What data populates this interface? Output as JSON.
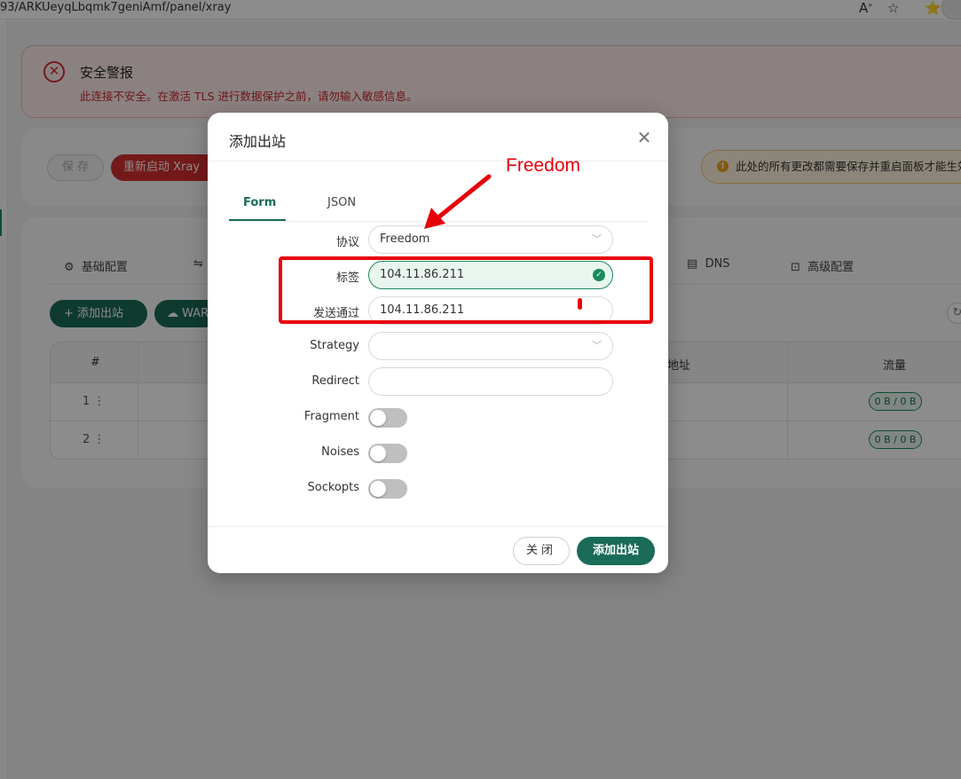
{
  "browser": {
    "url": "93/ARKUeyqLbqmk7geniAmf/panel/xray",
    "icons": [
      "read-aloud-icon",
      "favorite-star-icon",
      "reading-list-icon"
    ]
  },
  "alert": {
    "title": "安全警报",
    "description": "此连接不安全。在激活 TLS 进行数据保护之前，请勿输入敏感信息。"
  },
  "toolbar": {
    "save_label": "保 存",
    "restart_label": "重新启动 Xray",
    "notice": "此处的所有更改都需要保存并重启面板才能生效"
  },
  "page_tabs": [
    {
      "icon": "gear-icon",
      "label": "基础配置"
    },
    {
      "icon": "swap-icon",
      "label": ""
    },
    {
      "icon": "list-icon",
      "label": "DNS"
    },
    {
      "icon": "terminal-icon",
      "label": "高级配置"
    }
  ],
  "actions": {
    "add_outbound": "+ 添加出站",
    "warp": "WARP"
  },
  "table": {
    "headers": {
      "num": "#",
      "address": "地址",
      "traffic": "流量"
    },
    "rows": [
      {
        "num": "1",
        "traffic": "0 B / 0 B"
      },
      {
        "num": "2",
        "traffic": "0 B / 0 B"
      }
    ]
  },
  "modal": {
    "title": "添加出站",
    "tabs": {
      "form": "Form",
      "json": "JSON"
    },
    "fields": {
      "protocol": {
        "label": "协议",
        "value": "Freedom"
      },
      "tag": {
        "label": "标签",
        "value": "104.11.86.211"
      },
      "send_through": {
        "label": "发送通过",
        "value": "104.11.86.211"
      },
      "strategy": {
        "label": "Strategy",
        "value": ""
      },
      "redirect": {
        "label": "Redirect",
        "value": ""
      },
      "fragment": {
        "label": "Fragment",
        "on": false
      },
      "noises": {
        "label": "Noises",
        "on": false
      },
      "sockopts": {
        "label": "Sockopts",
        "on": false
      }
    },
    "close_label": "关闭",
    "submit_label": "添加出站"
  },
  "annotation": {
    "text": "Freedom",
    "color": "#e8000b"
  },
  "colors": {
    "primary": "#1a6b57",
    "danger": "#d32f2f",
    "warning_bg": "#fff4df"
  }
}
